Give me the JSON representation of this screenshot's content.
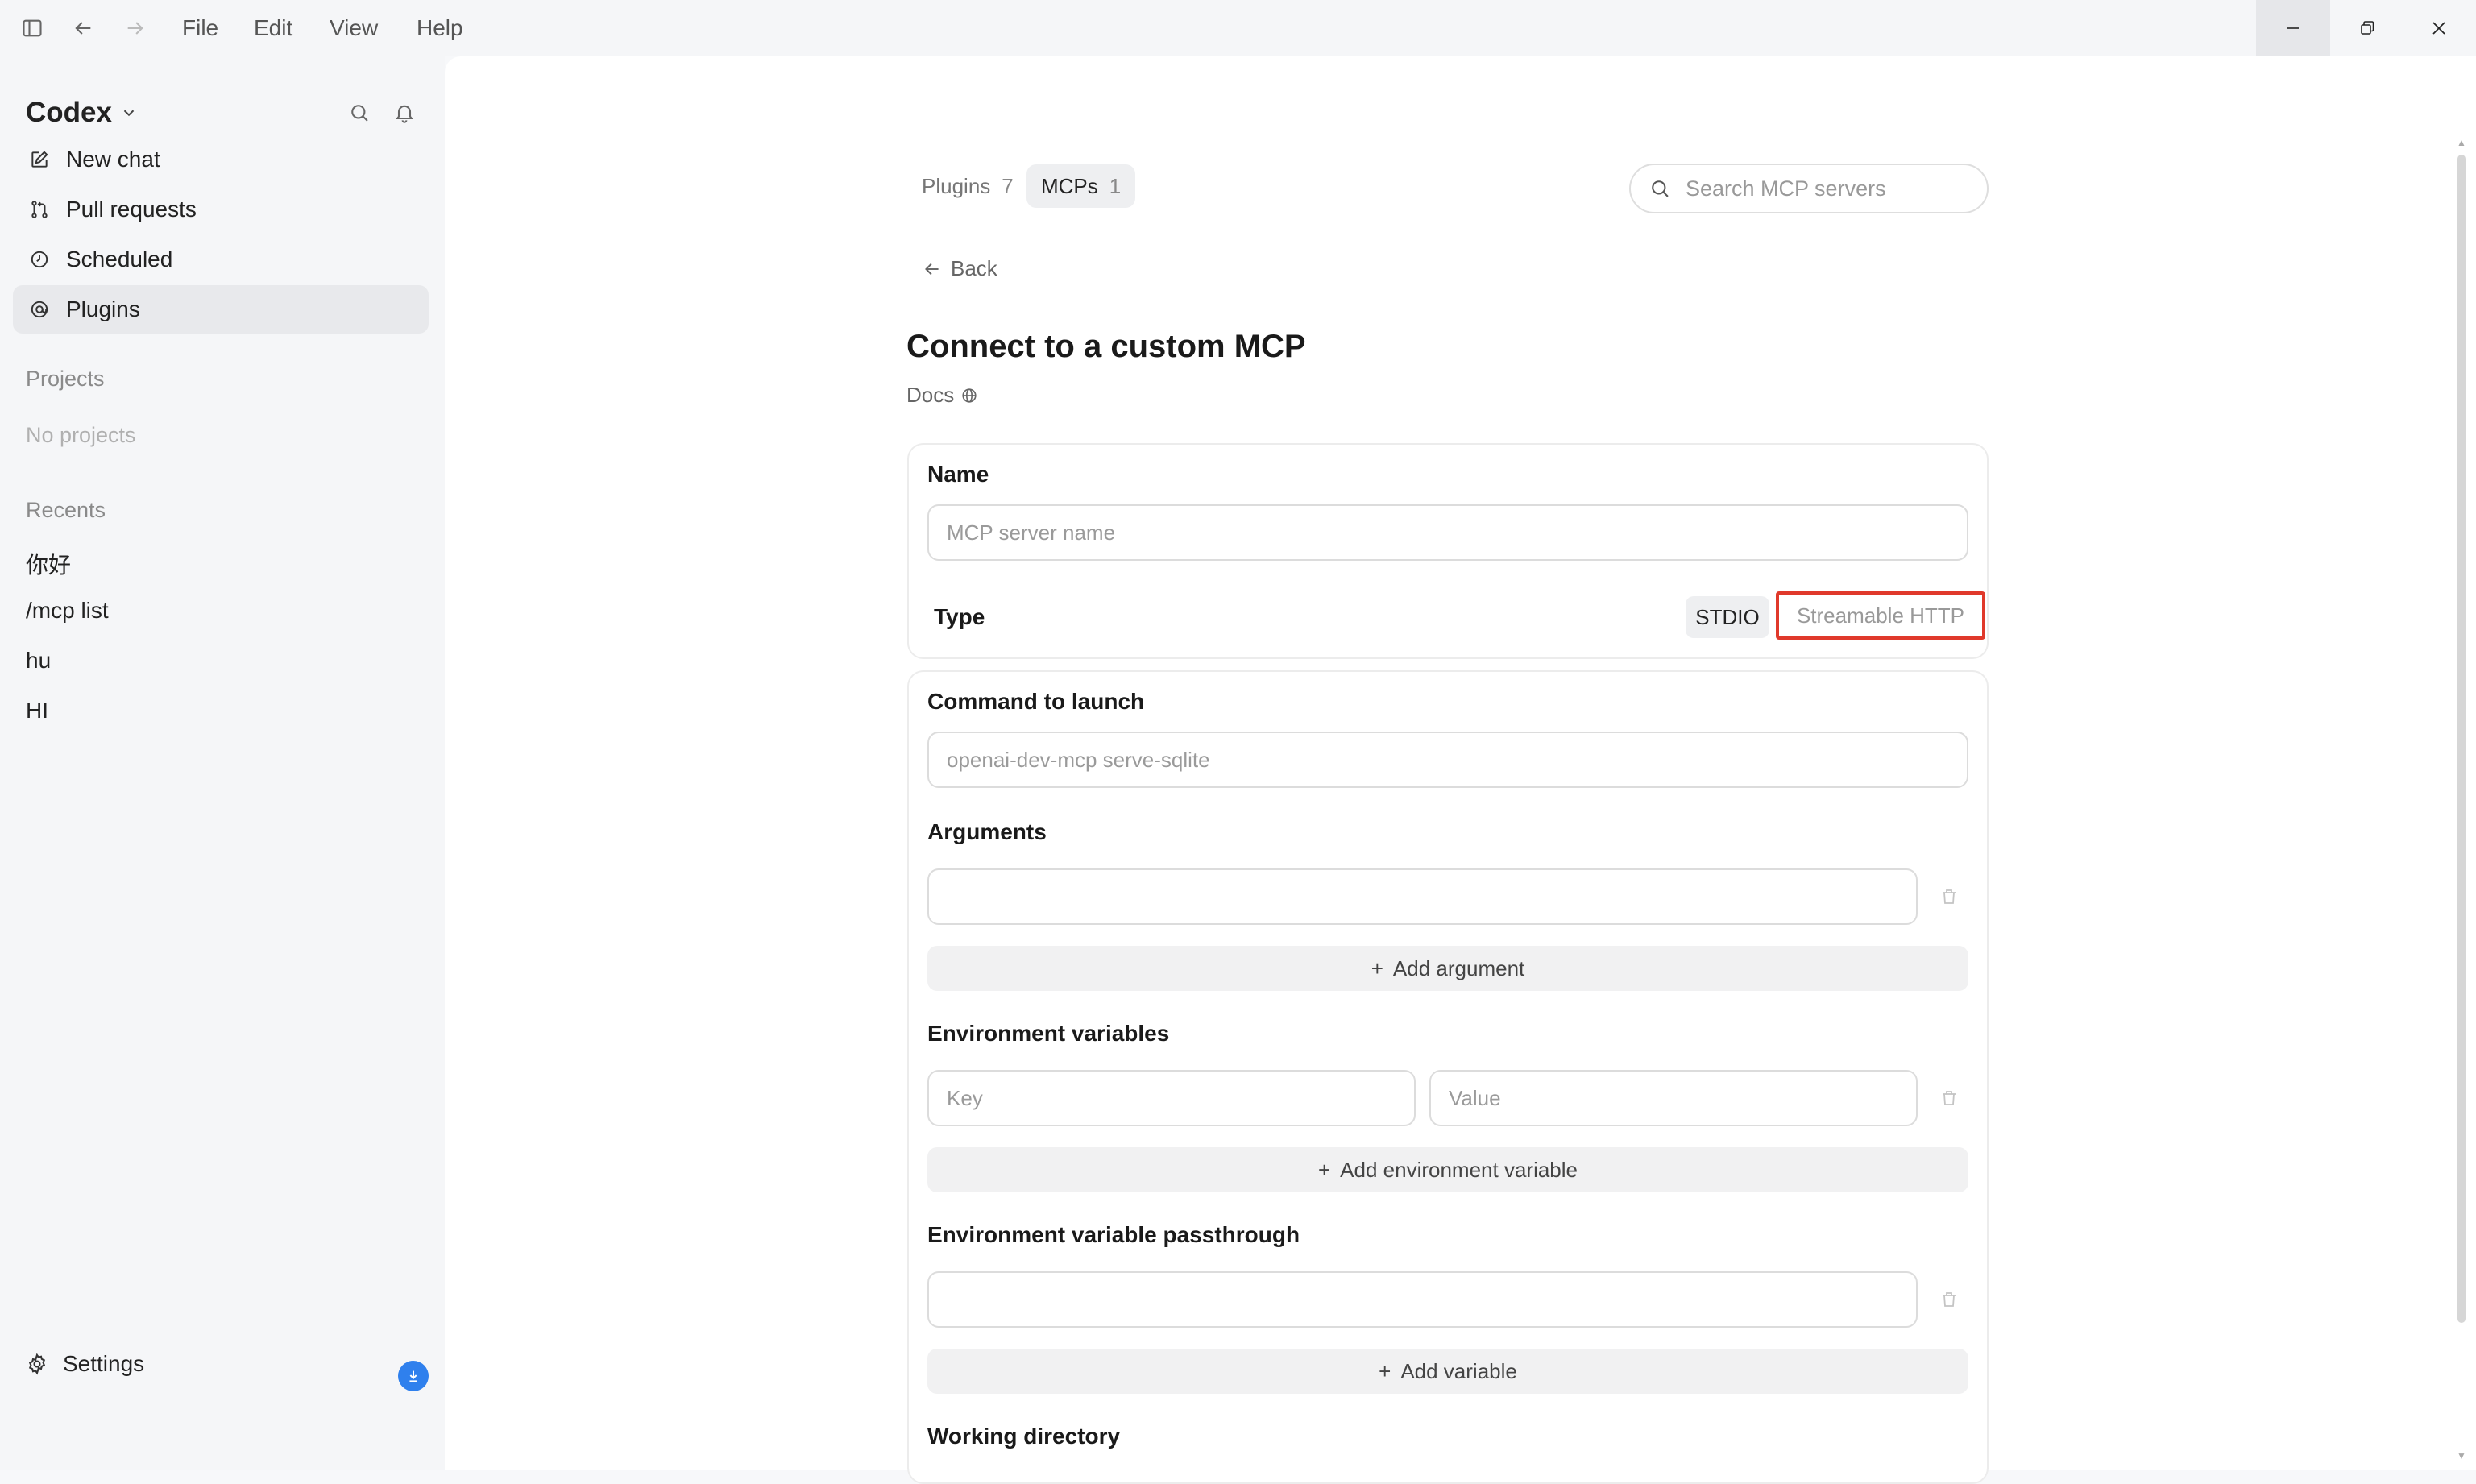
{
  "menu": {
    "file": "File",
    "edit": "Edit",
    "view": "View",
    "help": "Help"
  },
  "sidebar": {
    "brand": "Codex",
    "nav": [
      {
        "label": "New chat",
        "icon": "edit-icon"
      },
      {
        "label": "Pull requests",
        "icon": "pull-request-icon"
      },
      {
        "label": "Scheduled",
        "icon": "clock-icon"
      },
      {
        "label": "Plugins",
        "icon": "plugin-icon"
      }
    ],
    "projects_label": "Projects",
    "no_projects": "No projects",
    "recents_label": "Recents",
    "recents": [
      "你好",
      "/mcp list",
      "hu",
      "HI"
    ],
    "settings": "Settings"
  },
  "tabs": [
    {
      "label": "Plugins",
      "count": "7"
    },
    {
      "label": "MCPs",
      "count": "1"
    }
  ],
  "search": {
    "placeholder": "Search MCP servers"
  },
  "back": "Back",
  "title": "Connect to a custom MCP",
  "docs": "Docs",
  "form": {
    "name_label": "Name",
    "name_placeholder": "MCP server name",
    "type_label": "Type",
    "type_options": [
      "STDIO",
      "Streamable HTTP"
    ],
    "command_label": "Command to launch",
    "command_placeholder": "openai-dev-mcp serve-sqlite",
    "arguments_label": "Arguments",
    "add_argument": "Add argument",
    "env_label": "Environment variables",
    "env_key_placeholder": "Key",
    "env_value_placeholder": "Value",
    "add_env": "Add environment variable",
    "passthrough_label": "Environment variable passthrough",
    "add_variable": "Add variable",
    "workdir_label": "Working directory"
  },
  "colors": {
    "accent": "#2f80ed",
    "highlight": "#e0392b",
    "active_bg": "#e8e9ec"
  }
}
